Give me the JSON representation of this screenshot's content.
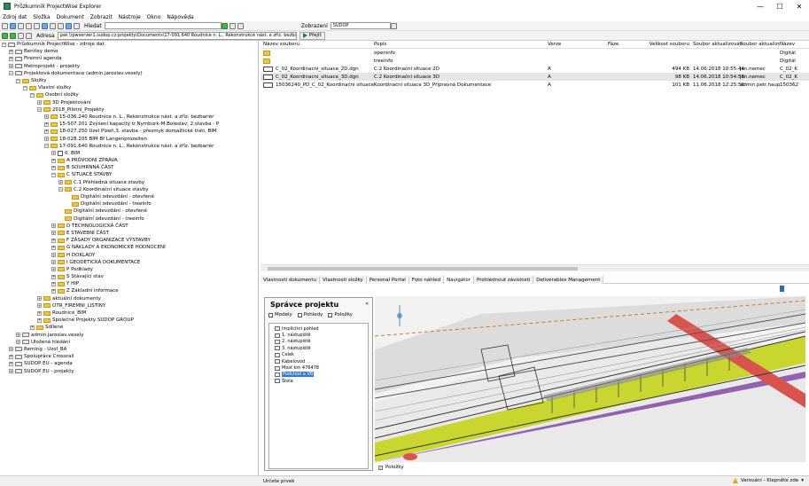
{
  "window": {
    "title": "Průzkumník ProjectWise Explorer",
    "controls": [
      "—",
      "☐",
      "✕"
    ]
  },
  "menu": [
    "Zdroj dat",
    "Složka",
    "Dokument",
    "Zobrazit",
    "Nástroje",
    "Okno",
    "Nápověda"
  ],
  "toolbar": {
    "search_label": "Hledat",
    "view_label": "Zobrazení",
    "view_value": "SUDOP"
  },
  "address": {
    "label": "Adresa",
    "value": "pwi:\\\\pwserver1.sudop.cz:projekty\\Documents\\17-091.640 Roudnice n. L., Rekonstrukce nást. a zříz. bezbariér",
    "go_label": "Přejít"
  },
  "tree": [
    {
      "label": "Průzkumník ProjectWise - zdroje dat",
      "level": 0,
      "kind": "db",
      "toggle": "−"
    },
    {
      "label": "Bentley demo",
      "level": 1,
      "kind": "db",
      "toggle": "+"
    },
    {
      "label": "Firemní agenda",
      "level": 1,
      "kind": "db",
      "toggle": "+"
    },
    {
      "label": "Metroprojekt - projekty",
      "level": 1,
      "kind": "db",
      "toggle": "+"
    },
    {
      "label": "Projektová dokumentace (admin.jaroslav.vesely)",
      "level": 1,
      "kind": "db",
      "toggle": "−"
    },
    {
      "label": "Složky",
      "level": 2,
      "kind": "folder",
      "toggle": "−"
    },
    {
      "label": "Vlastní složky",
      "level": 3,
      "kind": "folder",
      "toggle": "−"
    },
    {
      "label": "Osobní složky",
      "level": 4,
      "kind": "folder",
      "toggle": "−"
    },
    {
      "label": "3D Projektování",
      "level": 5,
      "kind": "folder",
      "toggle": "+"
    },
    {
      "label": "2018_Pilotní_Projekty",
      "level": 5,
      "kind": "folder",
      "toggle": "−"
    },
    {
      "label": "15-036.240 Roudnice n. L., Rekonstrukce nást. a zříz. bezbariér",
      "level": 6,
      "kind": "folder",
      "toggle": "+"
    },
    {
      "label": "15-507.201 Zvýšení kapacity tr.Nymburk-M.Boleslav, 2.stavba - P",
      "level": 6,
      "kind": "folder",
      "toggle": "+"
    },
    {
      "label": "18-027.250 Uzel Plzeň,3. stavba - přesmyk domažlické trati, BIM",
      "level": 6,
      "kind": "folder",
      "toggle": "+"
    },
    {
      "label": "18-028.205 BIM Bf Langenprozelten",
      "level": 6,
      "kind": "folder",
      "toggle": "+"
    },
    {
      "label": "17-091.640 Roudnice n. L., Rekonstrukce nást. a zříz. bezbariér",
      "level": 6,
      "kind": "folder",
      "toggle": "−"
    },
    {
      "label": "0. BIM",
      "level": 7,
      "kind": "doc",
      "toggle": "+"
    },
    {
      "label": "A PRŮVODNÍ ZPRÁVA",
      "level": 7,
      "kind": "folder",
      "toggle": "+"
    },
    {
      "label": "B SOUHRNNÁ ČÁST",
      "level": 7,
      "kind": "folder",
      "toggle": "+"
    },
    {
      "label": "C SITUACE STAVBY",
      "level": 7,
      "kind": "folder",
      "toggle": "−"
    },
    {
      "label": "C.1 Přehledná situace stavby",
      "level": 8,
      "kind": "folder",
      "toggle": "+"
    },
    {
      "label": "C.2 Koordinační situace stavby",
      "level": 8,
      "kind": "folder",
      "toggle": "−"
    },
    {
      "label": "Digitální odevzdání - otevřené",
      "level": 9,
      "kind": "folder",
      "toggle": ""
    },
    {
      "label": "Digitální odevzdání - treeinfo",
      "level": 9,
      "kind": "folder",
      "toggle": ""
    },
    {
      "label": "Digitální odevzdání - otevřené",
      "level": 8,
      "kind": "folder",
      "toggle": ""
    },
    {
      "label": "Digitální odevzdání - treeinfo",
      "level": 8,
      "kind": "folder",
      "toggle": ""
    },
    {
      "label": "D TECHNOLOGICKÁ ČÁST",
      "level": 7,
      "kind": "folder",
      "toggle": "+"
    },
    {
      "label": "E STAVEBNÍ ČÁST",
      "level": 7,
      "kind": "folder",
      "toggle": "+"
    },
    {
      "label": "F ZÁSADY ORGANIZACE VÝSTAVBY",
      "level": 7,
      "kind": "folder",
      "toggle": "+"
    },
    {
      "label": "G NÁKLADY A EKONOMICKÉ HODNOCENÍ",
      "level": 7,
      "kind": "folder",
      "toggle": "+"
    },
    {
      "label": "H DOKLADY",
      "level": 7,
      "kind": "folder",
      "toggle": "+"
    },
    {
      "label": "I GEODETICKÁ DOKUMENTACE",
      "level": 7,
      "kind": "folder",
      "toggle": "+"
    },
    {
      "label": "P Podklady",
      "level": 7,
      "kind": "folder",
      "toggle": "+"
    },
    {
      "label": "S Stávající stav",
      "level": 7,
      "kind": "folder",
      "toggle": "+"
    },
    {
      "label": "Y HIP",
      "level": 7,
      "kind": "folder",
      "toggle": "+"
    },
    {
      "label": "Z Základní informace",
      "level": 7,
      "kind": "folder",
      "toggle": "+"
    },
    {
      "label": "aktuální dokumenty",
      "level": 5,
      "kind": "folder",
      "toggle": "+"
    },
    {
      "label": "OTR_FIREMNI_LISTINY",
      "level": 5,
      "kind": "folder",
      "toggle": "+"
    },
    {
      "label": "Roudnice_BIM",
      "level": 5,
      "kind": "folder",
      "toggle": "+"
    },
    {
      "label": "Společné Projekty SUDOP GROUP",
      "level": 5,
      "kind": "folder",
      "toggle": "+"
    },
    {
      "label": "Sdílené",
      "level": 4,
      "kind": "folder",
      "toggle": "+"
    },
    {
      "label": "admin.jaroslav.vesely",
      "level": 2,
      "kind": "db",
      "toggle": "+"
    },
    {
      "label": "Uložená hledání",
      "level": 2,
      "kind": "db",
      "toggle": "+"
    },
    {
      "label": "Reming - Uzol_BA",
      "level": 1,
      "kind": "db",
      "toggle": "+"
    },
    {
      "label": "Spolupráce Crossrail",
      "level": 1,
      "kind": "db",
      "toggle": "+"
    },
    {
      "label": "SUDOP EU - agenda",
      "level": 1,
      "kind": "db",
      "toggle": "+"
    },
    {
      "label": "SUDOP EU - projekty",
      "level": 1,
      "kind": "db",
      "toggle": "+"
    }
  ],
  "filelist": {
    "headers": [
      "Název souboru",
      "Popis",
      "Verze",
      "Fáze",
      "Velikost souboru",
      "Soubor aktualizován",
      "Soubor aktualizoval",
      "Název"
    ],
    "rows": [
      {
        "name": "",
        "desc": "openinfo",
        "ver": "",
        "phase": "",
        "size": "",
        "date": "",
        "by": "",
        "title": "Digitál",
        "icon": "folder",
        "selected": false
      },
      {
        "name": "",
        "desc": "treeinfo",
        "ver": "",
        "phase": "",
        "size": "",
        "date": "",
        "by": "",
        "title": "Digitál",
        "icon": "folder",
        "selected": false
      },
      {
        "name": "C_02_Koordinacni_situace_2D.dgn",
        "desc": "C.2 Koordinační situace 2D",
        "ver": "A",
        "phase": "",
        "size": "494 KB",
        "date": "14.06.2018 10:55:44",
        "by": "jan.nemec",
        "title": "C_02_K",
        "icon": "dgn",
        "selected": false
      },
      {
        "name": "C_02_Koordinacni_situace_3D.dgn",
        "desc": "C.2 Koordinační situace 3D",
        "ver": "A",
        "phase": "",
        "size": "98 KB",
        "date": "14.06.2018 10:54:58",
        "by": "jan.nemec",
        "title": "C_02_K",
        "icon": "dgn",
        "selected": true
      },
      {
        "name": "15036240_PD_C_02_Koordinační situace 3D...",
        "desc": "Koordinační situace 3D_Připravná Dokumentace",
        "ver": "A",
        "phase": "",
        "size": "101 KB",
        "date": "11.06.2018 12:25:56",
        "by": "admin.petr.haupt",
        "title": "150362",
        "icon": "dgn",
        "selected": false
      }
    ]
  },
  "tabs": [
    "Vlastnosti dokumentu",
    "Vlastnosti složky",
    "Personal Portal",
    "Foto náhled",
    "Navigátor",
    "Prohlédnout závislosti",
    "Deliverables Management"
  ],
  "active_tab": "Navigátor",
  "manager": {
    "title": "Správce projektu",
    "collapse": "«",
    "tabs": [
      "Modely",
      "Pohledy",
      "Položky"
    ],
    "views": [
      "Implicitní pohled",
      "1. nástupiště",
      "2. nástupiště",
      "3. nástupiště",
      "Celek",
      "Kabelovod",
      "Most km 476478",
      "Podchod a VB",
      "Štola"
    ],
    "selected_view": "Podchod a VB"
  },
  "items_label": "Položky",
  "status": {
    "left": "Určete prvek",
    "warning": "Varování - Klepněte zde",
    "warning_arrow": "▾"
  },
  "colors": {
    "platform": "#c9d62f",
    "rail_red": "#d9534f",
    "subway": "#7e3fa0",
    "selection": "#3478d6"
  }
}
